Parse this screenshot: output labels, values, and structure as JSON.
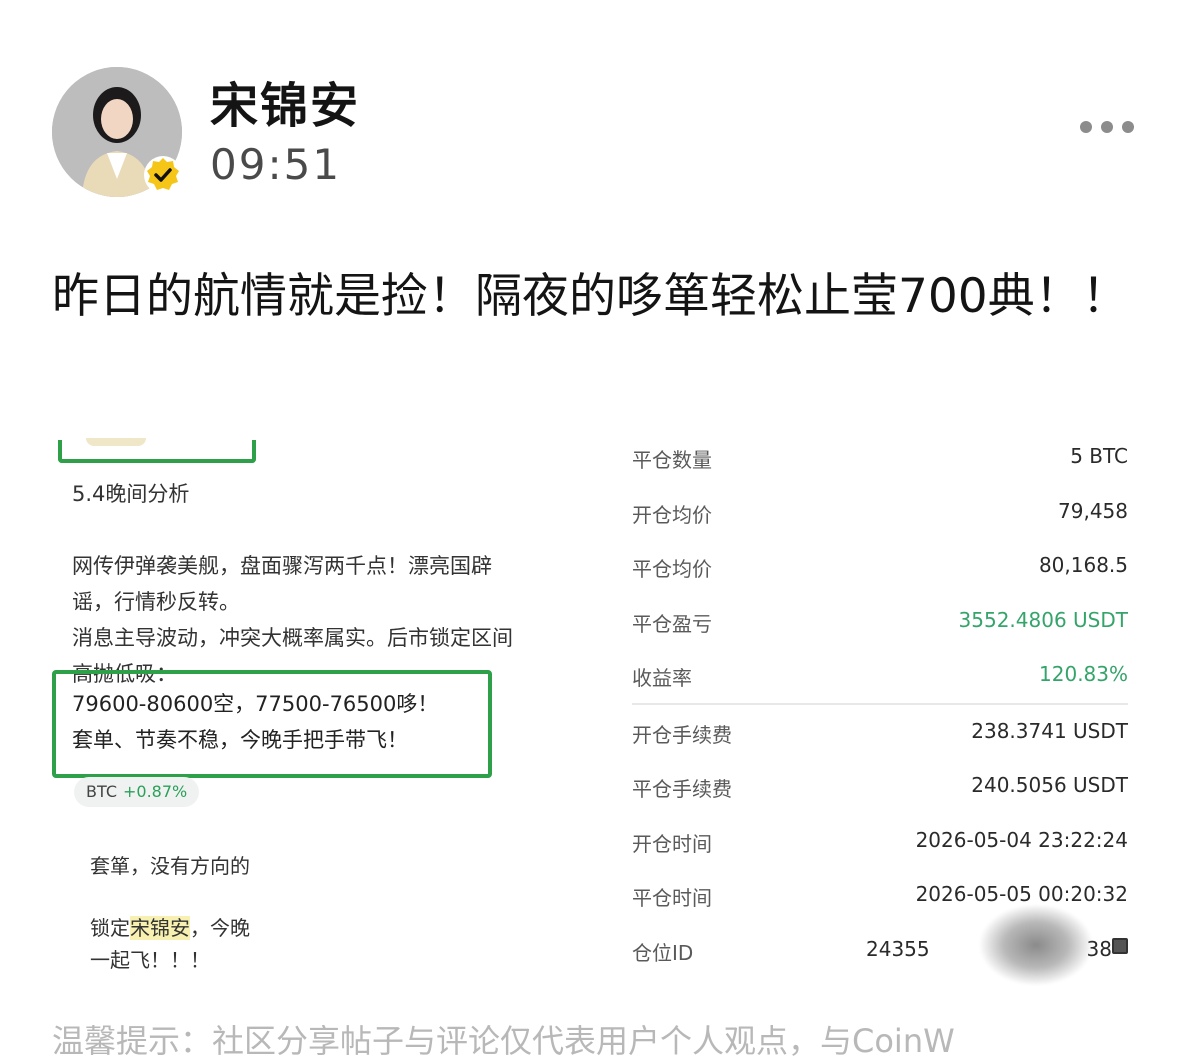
{
  "header": {
    "author_name": "宋锦安",
    "time": "09:51",
    "avatar_icon": "user-avatar",
    "verified_icon": "verified-check-icon",
    "more_icon": "more-dots-icon"
  },
  "post": {
    "text": "昨日的航情就是捡！隔夜的哆箪轻松止莹700典！！"
  },
  "screenshot_left": {
    "title": "5.4晚间分析",
    "body_lines": [
      "网传伊弹袭美舰，盘面骤泻两千点！漂亮国辟",
      "谣，行情秒反转。",
      "消息主导波动，冲突大概率属实。后市锁定区间",
      "高抛低吸："
    ],
    "box_lines": [
      "79600-80600空，77500-76500哆！",
      "套单、节奏不稳，今晚手把手带飞！"
    ],
    "ticker": "BTC",
    "ticker_change": "+0.87%",
    "chat_line1": "套箪，没有方向的",
    "chat_line2_prefix": "锁定",
    "chat_line2_highlight": "宋锦安",
    "chat_line2_suffix": "，今晚",
    "chat_line3": "一起飞！！！"
  },
  "stats": [
    {
      "label": "平仓数量",
      "value": "5 BTC",
      "green": false
    },
    {
      "label": "开仓均价",
      "value": "79,458",
      "green": false
    },
    {
      "label": "平仓均价",
      "value": "80,168.5",
      "green": false
    },
    {
      "label": "平仓盈亏",
      "value": "3552.4806 USDT",
      "green": true
    },
    {
      "label": "收益率",
      "value": "120.83%",
      "green": true
    },
    {
      "label": "开仓手续费",
      "value": "238.3741 USDT",
      "green": false
    },
    {
      "label": "平仓手续费",
      "value": "240.5056 USDT",
      "green": false
    },
    {
      "label": "开仓时间",
      "value": "2026-05-04 23:22:24",
      "green": false
    },
    {
      "label": "平仓时间",
      "value": "2026-05-05 00:20:32",
      "green": false
    },
    {
      "label": "仓位ID",
      "value": "24355",
      "value_tail": "38",
      "green": false
    }
  ],
  "colors": {
    "accent_green": "#2ea04a",
    "profit_green": "#35a46a",
    "badge_yellow": "#f5c518"
  },
  "footer": {
    "text": "温馨提示：社区分享帖子与评论仅代表用户个人观点，与CoinW"
  }
}
